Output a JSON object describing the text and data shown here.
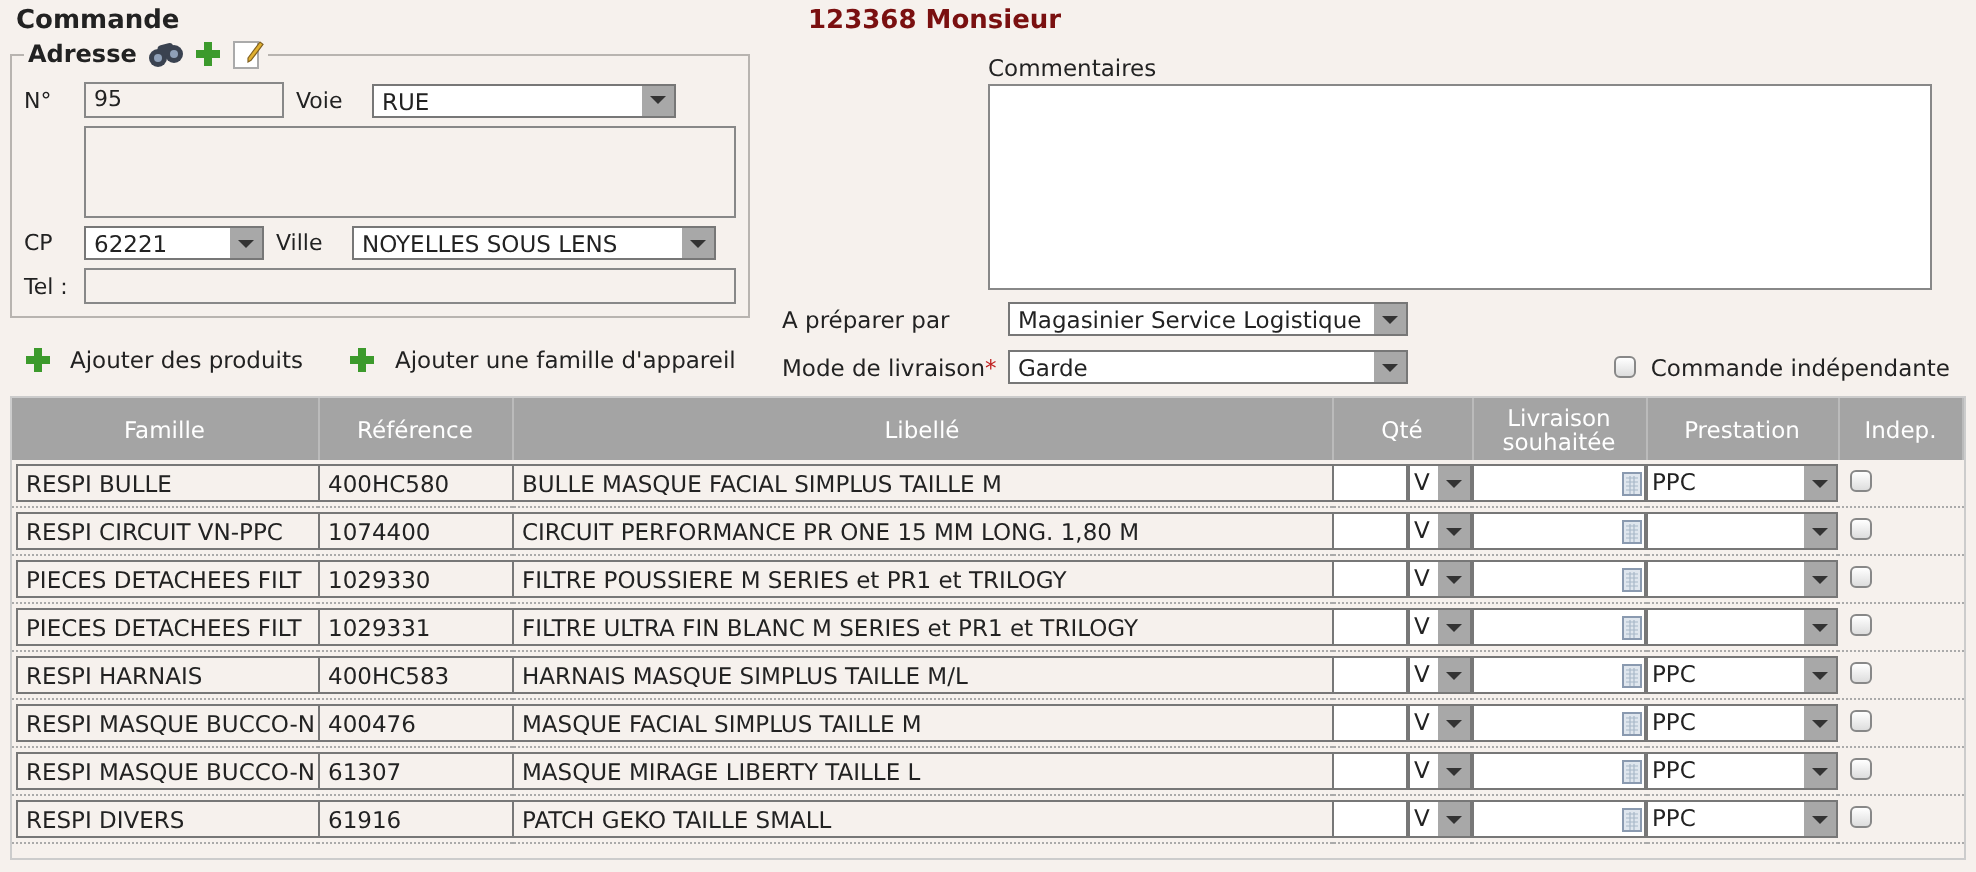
{
  "header": {
    "title": "Commande",
    "order": "123368 Monsieur"
  },
  "address": {
    "legend": "Adresse",
    "number_label": "N°",
    "number": "95",
    "voie_label": "Voie",
    "voie": "RUE",
    "cp_label": "CP",
    "cp": "62221",
    "ville_label": "Ville",
    "ville": "NOYELLES SOUS LENS",
    "tel_label": "Tel :"
  },
  "comments": {
    "label": "Commentaires"
  },
  "prepare": {
    "label": "A préparer par",
    "value": "Magasinier Service Logistique"
  },
  "delivery": {
    "label": "Mode de livraison",
    "required_mark": "*",
    "value": "Garde"
  },
  "independent": {
    "label": "Commande indépendante",
    "checked": false
  },
  "actions": [
    "Ajouter des produits",
    "Ajouter une famille d'appareil"
  ],
  "table": {
    "columns": [
      "Famille",
      "Référence",
      "Libellé",
      "Qté",
      "Livraison souhaitée",
      "Prestation",
      "Indep."
    ],
    "rows": [
      {
        "famille": "RESPI BULLE",
        "reference": "400HC580",
        "libelle": "BULLE MASQUE FACIAL SIMPLUS TAILLE M",
        "unit": "V",
        "prestation": "PPC",
        "indep": false
      },
      {
        "famille": "RESPI CIRCUIT VN-PPC",
        "reference": "1074400",
        "libelle": "CIRCUIT PERFORMANCE PR ONE 15 MM LONG. 1,80 M",
        "unit": "V",
        "indep": false
      },
      {
        "famille": "PIECES DETACHEES FILT",
        "reference": "1029330",
        "libelle": "FILTRE POUSSIERE M SERIES et PR1 et TRILOGY",
        "unit": "V",
        "indep": false
      },
      {
        "famille": "PIECES DETACHEES FILT",
        "reference": "1029331",
        "libelle": "FILTRE ULTRA FIN BLANC M SERIES et PR1 et TRILOGY",
        "unit": "V",
        "indep": false
      },
      {
        "famille": "RESPI HARNAIS",
        "reference": "400HC583",
        "libelle": "HARNAIS MASQUE SIMPLUS TAILLE M/L",
        "unit": "V",
        "prestation": "PPC",
        "indep": false
      },
      {
        "famille": "RESPI MASQUE BUCCO-N",
        "reference": "400476",
        "libelle": "MASQUE FACIAL SIMPLUS TAILLE M",
        "unit": "V",
        "prestation": "PPC",
        "indep": false
      },
      {
        "famille": "RESPI MASQUE BUCCO-N",
        "reference": "61307",
        "libelle": "MASQUE MIRAGE LIBERTY TAILLE L",
        "unit": "V",
        "prestation": "PPC",
        "indep": false
      },
      {
        "famille": "RESPI DIVERS",
        "reference": "61916",
        "libelle": "PATCH GEKO TAILLE SMALL",
        "unit": "V",
        "prestation": "PPC",
        "indep": false
      }
    ]
  }
}
